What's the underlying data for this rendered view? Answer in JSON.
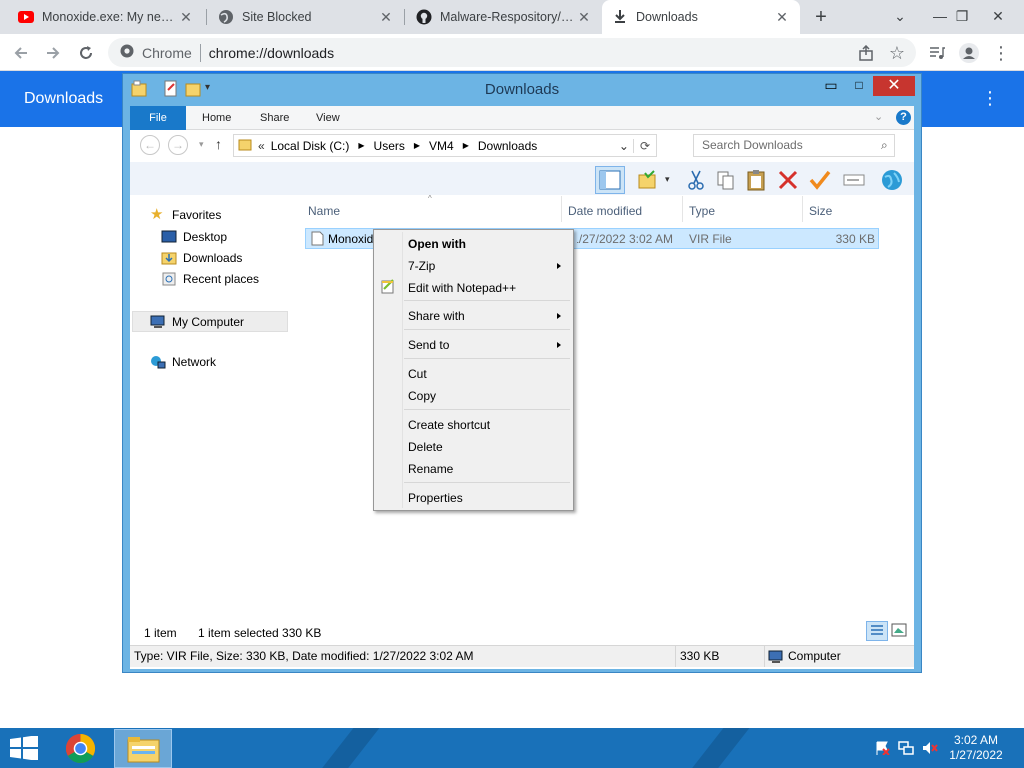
{
  "browser": {
    "tabs": [
      {
        "title": "Monoxide.exe: My new sp",
        "icon": "youtube-icon",
        "active": false
      },
      {
        "title": "Site Blocked",
        "icon": "globe-icon",
        "active": false
      },
      {
        "title": "Malware-Respository/Mo",
        "icon": "github-icon",
        "active": false
      },
      {
        "title": "Downloads",
        "icon": "download-icon",
        "active": true
      }
    ],
    "new_tab": "+",
    "omnibox": {
      "label": "Chrome",
      "url": "chrome://downloads"
    },
    "page_title": "Downloads"
  },
  "explorer": {
    "title": "Downloads",
    "window_controls": {
      "minimize": "▭",
      "maximize": "□",
      "close": "✕"
    },
    "ribbon_tabs": [
      "File",
      "Home",
      "Share",
      "View"
    ],
    "address": {
      "prefix": "«",
      "path": [
        "Local Disk (C:)",
        "Users",
        "VM4",
        "Downloads"
      ]
    },
    "search_placeholder": "Search Downloads",
    "nav": {
      "favorites": "Favorites",
      "favorite_items": [
        "Desktop",
        "Downloads",
        "Recent places"
      ],
      "my_computer": "My Computer",
      "network": "Network"
    },
    "columns": [
      "Name",
      "Date modified",
      "Type",
      "Size"
    ],
    "file": {
      "name": "Monoxide",
      "date": "1/27/2022 3:02 AM",
      "type": "VIR File",
      "size": "330 KB"
    },
    "status": {
      "items": "1 item",
      "selected": "1 item selected  330 KB",
      "details": "Type: VIR File, Size: 330 KB, Date modified: 1/27/2022 3:02 AM",
      "size": "330 KB",
      "location": "Computer"
    }
  },
  "context_menu": {
    "open_with": "Open with",
    "seven_zip": "7-Zip",
    "edit_notepad": "Edit with Notepad++",
    "share_with": "Share with",
    "send_to": "Send to",
    "cut": "Cut",
    "copy": "Copy",
    "create_shortcut": "Create shortcut",
    "delete": "Delete",
    "rename": "Rename",
    "properties": "Properties"
  },
  "taskbar": {
    "time": "3:02 AM",
    "date": "1/27/2022"
  },
  "colors": {
    "chrome_blue": "#1a73e8",
    "taskbar": "#1971b9",
    "selection": "#cce8ff",
    "window_frame": "#6cb4e4"
  }
}
